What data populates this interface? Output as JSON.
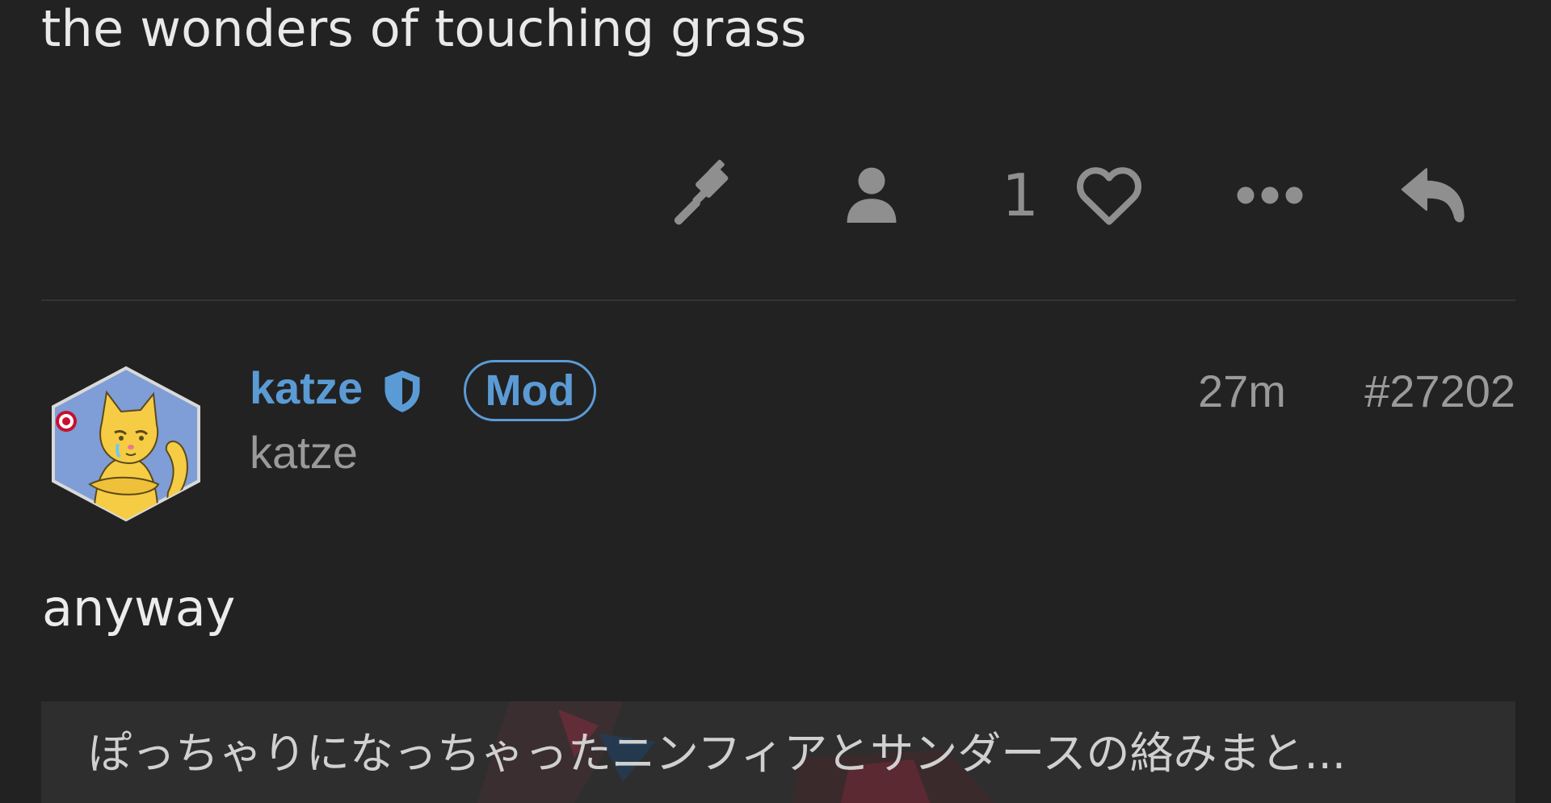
{
  "previous_post": {
    "body_text": "the wonders of touching grass"
  },
  "post_actions": {
    "icons": [
      "gavel-icon",
      "user-icon",
      "heart-icon",
      "more-icon",
      "reply-icon"
    ],
    "like_count": "1"
  },
  "post": {
    "author": {
      "username": "katze",
      "display_name": "katze",
      "badge": "Mod",
      "accent_color": "#5b9bd5"
    },
    "timestamp": "27m",
    "post_number": "#27202",
    "body_text": "anyway",
    "embed": {
      "title": "ぽっちゃりになっちゃったニンフィアとサンダースの絡みまと..."
    }
  },
  "colors": {
    "background": "#222222",
    "icon_gray": "#8f8f8f",
    "divider": "#333333",
    "accent": "#5b9bd5"
  }
}
